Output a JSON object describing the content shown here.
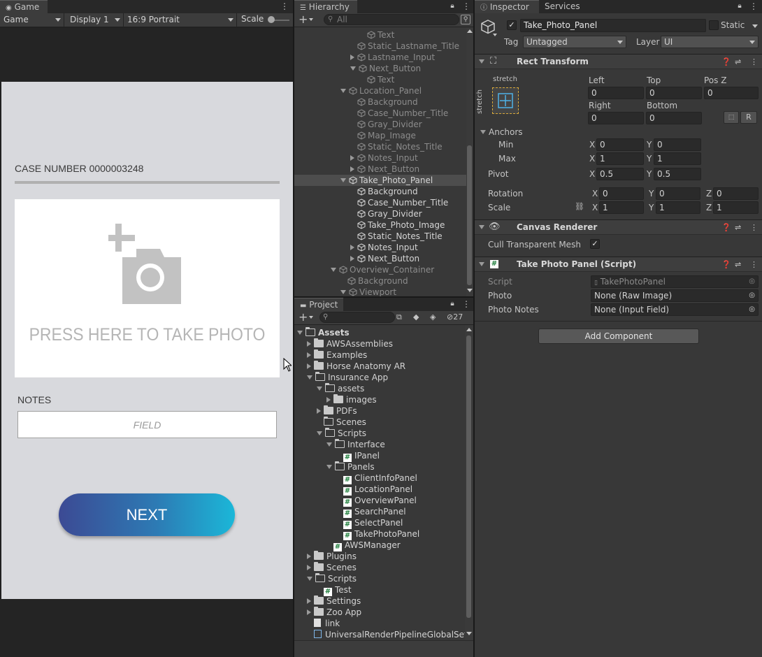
{
  "game": {
    "tab": "Game",
    "toolbar": {
      "mode": "Game",
      "display": "Display 1",
      "aspect": "16:9 Portrait",
      "scale_label": "Scale"
    },
    "app": {
      "case_number": "CASE NUMBER 0000003248",
      "photo_prompt": "PRESS HERE TO TAKE PHOTO",
      "notes_label": "NOTES",
      "notes_placeholder": "FIELD",
      "next_button": "NEXT"
    }
  },
  "hierarchy": {
    "tab": "Hierarchy",
    "search_placeholder": "All",
    "items": [
      {
        "label": "Text",
        "indent": 7,
        "arrow": "",
        "dim": true
      },
      {
        "label": "Static_Lastname_Title",
        "indent": 6,
        "arrow": "",
        "dim": true
      },
      {
        "label": "Lastname_Input",
        "indent": 6,
        "arrow": "right",
        "dim": true
      },
      {
        "label": "Next_Button",
        "indent": 6,
        "arrow": "down",
        "dim": true
      },
      {
        "label": "Text",
        "indent": 7,
        "arrow": "",
        "dim": true
      },
      {
        "label": "Location_Panel",
        "indent": 5,
        "arrow": "down",
        "dim": true
      },
      {
        "label": "Background",
        "indent": 6,
        "arrow": "",
        "dim": true
      },
      {
        "label": "Case_Number_Title",
        "indent": 6,
        "arrow": "",
        "dim": true
      },
      {
        "label": "Gray_Divider",
        "indent": 6,
        "arrow": "",
        "dim": true
      },
      {
        "label": "Map_Image",
        "indent": 6,
        "arrow": "",
        "dim": true
      },
      {
        "label": "Static_Notes_Title",
        "indent": 6,
        "arrow": "",
        "dim": true
      },
      {
        "label": "Notes_Input",
        "indent": 6,
        "arrow": "right",
        "dim": true
      },
      {
        "label": "Next_Button",
        "indent": 6,
        "arrow": "right",
        "dim": true
      },
      {
        "label": "Take_Photo_Panel",
        "indent": 5,
        "arrow": "down",
        "dim": false,
        "selected": true
      },
      {
        "label": "Background",
        "indent": 6,
        "arrow": "",
        "dim": false
      },
      {
        "label": "Case_Number_Title",
        "indent": 6,
        "arrow": "",
        "dim": false
      },
      {
        "label": "Gray_Divider",
        "indent": 6,
        "arrow": "",
        "dim": false
      },
      {
        "label": "Take_Photo_Image",
        "indent": 6,
        "arrow": "",
        "dim": false
      },
      {
        "label": "Static_Notes_Title",
        "indent": 6,
        "arrow": "",
        "dim": false
      },
      {
        "label": "Notes_Input",
        "indent": 6,
        "arrow": "right",
        "dim": false
      },
      {
        "label": "Next_Button",
        "indent": 6,
        "arrow": "right",
        "dim": false
      },
      {
        "label": "Overview_Container",
        "indent": 4,
        "arrow": "down",
        "dim": true
      },
      {
        "label": "Background",
        "indent": 5,
        "arrow": "",
        "dim": true
      },
      {
        "label": "Viewport",
        "indent": 5,
        "arrow": "down",
        "dim": true
      }
    ]
  },
  "project": {
    "tab": "Project",
    "hidden_count": "27",
    "items": [
      {
        "label": "Assets",
        "indent": 0,
        "arrow": "down",
        "icon": "folder-open",
        "bold": true
      },
      {
        "label": "AWSAssemblies",
        "indent": 1,
        "arrow": "right",
        "icon": "folder"
      },
      {
        "label": "Examples",
        "indent": 1,
        "arrow": "right",
        "icon": "folder"
      },
      {
        "label": "Horse Anatomy AR",
        "indent": 1,
        "arrow": "right",
        "icon": "folder"
      },
      {
        "label": "Insurance App",
        "indent": 1,
        "arrow": "down",
        "icon": "folder-open"
      },
      {
        "label": "assets",
        "indent": 2,
        "arrow": "down",
        "icon": "folder-open"
      },
      {
        "label": "images",
        "indent": 3,
        "arrow": "right",
        "icon": "folder"
      },
      {
        "label": "PDFs",
        "indent": 2,
        "arrow": "right",
        "icon": "folder"
      },
      {
        "label": "Scenes",
        "indent": 2,
        "arrow": "",
        "icon": "folder-open"
      },
      {
        "label": "Scripts",
        "indent": 2,
        "arrow": "down",
        "icon": "folder-open"
      },
      {
        "label": "Interface",
        "indent": 3,
        "arrow": "down",
        "icon": "folder-open"
      },
      {
        "label": "IPanel",
        "indent": 4,
        "arrow": "",
        "icon": "script"
      },
      {
        "label": "Panels",
        "indent": 3,
        "arrow": "down",
        "icon": "folder-open"
      },
      {
        "label": "ClientInfoPanel",
        "indent": 4,
        "arrow": "",
        "icon": "script"
      },
      {
        "label": "LocationPanel",
        "indent": 4,
        "arrow": "",
        "icon": "script"
      },
      {
        "label": "OverviewPanel",
        "indent": 4,
        "arrow": "",
        "icon": "script"
      },
      {
        "label": "SearchPanel",
        "indent": 4,
        "arrow": "",
        "icon": "script"
      },
      {
        "label": "SelectPanel",
        "indent": 4,
        "arrow": "",
        "icon": "script"
      },
      {
        "label": "TakePhotoPanel",
        "indent": 4,
        "arrow": "",
        "icon": "script"
      },
      {
        "label": "AWSManager",
        "indent": 3,
        "arrow": "",
        "icon": "script"
      },
      {
        "label": "Plugins",
        "indent": 1,
        "arrow": "right",
        "icon": "folder"
      },
      {
        "label": "Scenes",
        "indent": 1,
        "arrow": "right",
        "icon": "folder"
      },
      {
        "label": "Scripts",
        "indent": 1,
        "arrow": "down",
        "icon": "folder-open"
      },
      {
        "label": "Test",
        "indent": 2,
        "arrow": "",
        "icon": "script"
      },
      {
        "label": "Settings",
        "indent": 1,
        "arrow": "right",
        "icon": "folder"
      },
      {
        "label": "Zoo App",
        "indent": 1,
        "arrow": "right",
        "icon": "folder"
      },
      {
        "label": "link",
        "indent": 1,
        "arrow": "",
        "icon": "file"
      },
      {
        "label": "UniversalRenderPipelineGlobalSet",
        "indent": 1,
        "arrow": "",
        "icon": "asset"
      }
    ]
  },
  "inspector": {
    "tab": "Inspector",
    "tab2": "Services",
    "object_name": "Take_Photo_Panel",
    "static_label": "Static",
    "tag_label": "Tag",
    "tag_value": "Untagged",
    "layer_label": "Layer",
    "layer_value": "UI",
    "rect_transform": {
      "title": "Rect Transform",
      "anchor_preset_top": "stretch",
      "anchor_preset_side": "stretch",
      "left_label": "Left",
      "left": "0",
      "top_label": "Top",
      "top": "0",
      "posz_label": "Pos Z",
      "posz": "0",
      "right_label": "Right",
      "right": "0",
      "bottom_label": "Bottom",
      "bottom": "0",
      "r_button": "R",
      "anchors_label": "Anchors",
      "min_label": "Min",
      "min_x": "0",
      "min_y": "0",
      "max_label": "Max",
      "max_x": "1",
      "max_y": "1",
      "pivot_label": "Pivot",
      "pivot_x": "0.5",
      "pivot_y": "0.5",
      "rotation_label": "Rotation",
      "rot_x": "0",
      "rot_y": "0",
      "rot_z": "0",
      "scale_label": "Scale",
      "scale_x": "1",
      "scale_y": "1",
      "scale_z": "1",
      "x": "X",
      "y": "Y",
      "z": "Z"
    },
    "canvas_renderer": {
      "title": "Canvas Renderer",
      "cull_label": "Cull Transparent Mesh"
    },
    "script_component": {
      "title": "Take Photo Panel (Script)",
      "script_label": "Script",
      "script_value": "TakePhotoPanel",
      "photo_label": "Photo",
      "photo_value": "None (Raw Image)",
      "notes_label": "Photo Notes",
      "notes_value": "None (Input Field)"
    },
    "add_component": "Add Component"
  }
}
